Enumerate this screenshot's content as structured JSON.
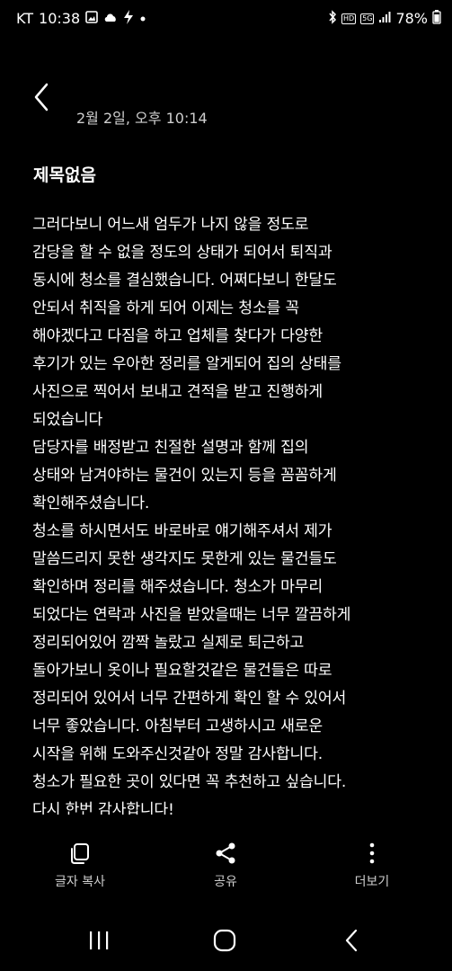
{
  "status_bar": {
    "carrier": "KT",
    "time": "10:38",
    "left_icons": [
      "gallery-icon",
      "cloud-icon",
      "bolt-icon",
      "dot-icon"
    ],
    "right_icons": [
      "bluetooth-icon",
      "hd-icon",
      "5g-icon",
      "signal-icon"
    ],
    "hd_label": "HD",
    "network_label": "5G",
    "battery": "78%"
  },
  "header": {
    "date": "2월 2일, 오후 10:14",
    "title": "제목없음"
  },
  "message": {
    "body": "그러다보니 어느새 엄두가 나지 않을 정도로\n그러다보니 어느새 엄두가 나지 않을 정도로\n감당을 할 수 없을 정도의 상태가 되어서 퇴직과\n동시에 청소를 결심했습니다. 어쩌다보니 한달도\n안되서 취직을 하게 되어 이제는 청소를 꼭\n해야겠다고 다짐을 하고 업체를 찾다가 다양한\n후기가 있는 우아한 정리를 알게되어 집의 상태를\n사진으로 찍어서 보내고 견적을 받고 진행하게\n되었습니다\n담당자를 배정받고 친절한 설명과 함께 집의\n상태와 남겨야하는 물건이 있는지 등을 꼼꼼하게\n확인해주셨습니다.\n청소를 하시면서도 바로바로 얘기해주셔서 제가\n말씀드리지 못한 생각지도 못한게 있는 물건들도\n확인하며 정리를 해주셨습니다. 청소가 마무리\n되었다는 연락과 사진을 받았을때는 너무 깔끔하게\n정리되어있어 깜짝 놀랐고 실제로 퇴근하고\n돌아가보니 옷이나 필요할것같은 물건들은 따로\n정리되어 있어서 너무 간편하게 확인 할 수 있어서\n너무 좋았습니다. 아침부터 고생하시고 새로운\n시작을 위해 도와주신것같아 정말 감사합니다.\n청소가 필요한 곳이 있다면 꼭 추천하고 싶습니다.\n다시 한번 감사합니다!"
  },
  "actions": [
    {
      "label": "글자 복사",
      "icon": "copy-icon"
    },
    {
      "label": "공유",
      "icon": "share-icon"
    },
    {
      "label": "더보기",
      "icon": "more-icon"
    }
  ],
  "nav": {
    "recent_icon": "recent-apps-icon",
    "home_icon": "home-icon",
    "back_icon": "back-icon"
  },
  "colors": {
    "background": "#000000",
    "text": "#ffffff",
    "secondary_text": "#cfcfcf"
  }
}
